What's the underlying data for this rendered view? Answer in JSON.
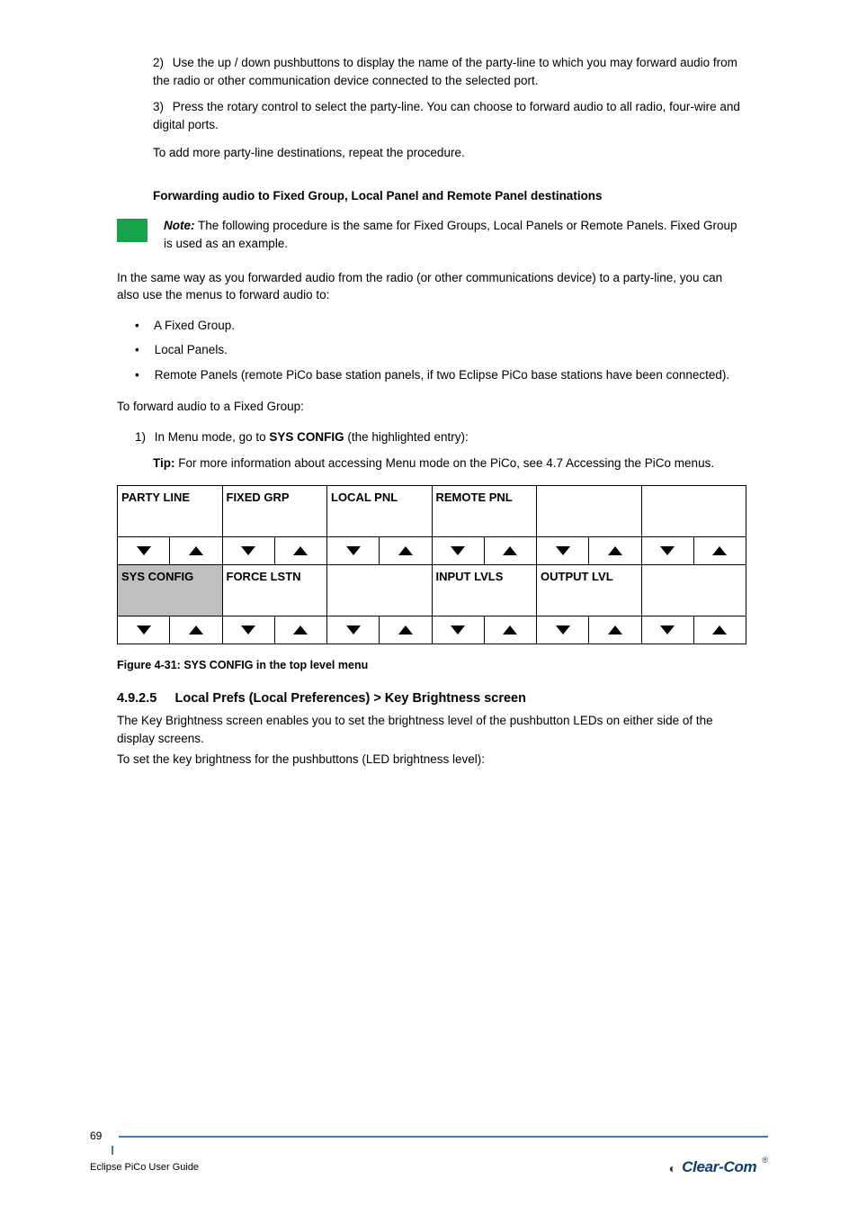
{
  "list": [
    {
      "marker": "2)",
      "text": "Use the up / down pushbuttons to display the name of the party-line to which you may forward audio from the radio or other communication device connected to the selected port."
    },
    {
      "marker": "3)",
      "text": "Press the rotary control to select the party-line. You can choose to forward audio to all radio, four-wire and digital ports."
    }
  ],
  "body1": "To add more party-line destinations, repeat the procedure.",
  "body2": "Forwarding audio to Fixed Group, Local Panel and Remote Panel destinations",
  "note": {
    "kw": "Note:",
    "text": "The following procedure is the same for Fixed Groups, Local Panels or Remote Panels. Fixed Group is used as an example."
  },
  "body3": "In the same way as you forwarded audio from the radio (or other communications device) to a party-line, you can also use the menus to forward audio to:",
  "bullets": [
    {
      "marker": "•",
      "text": "A Fixed Group."
    },
    {
      "marker": "•",
      "text": "Local Panels."
    },
    {
      "marker": "•",
      "text": "Remote Panels (remote PiCo base station panels, if two Eclipse PiCo base stations have been connected)."
    }
  ],
  "body4": "To forward audio to a Fixed Group:",
  "step1": {
    "marker": "1)",
    "text_pre": "In Menu mode, go to ",
    "bold": "SYS CONFIG",
    "text_post": " (the highlighted entry):"
  },
  "tip": {
    "kw": "Tip:",
    "text": "For more information about accessing Menu mode on the PiCo, see 4.7 Accessing the PiCo menus."
  },
  "menu": {
    "row1": [
      "PARTY LINE",
      "FIXED GRP",
      "LOCAL PNL",
      "REMOTE PNL",
      "",
      ""
    ],
    "row2": [
      "SYS CONFIG",
      "FORCE LSTN",
      "",
      "INPUT LVLS",
      "OUTPUT LVL",
      ""
    ],
    "selected": "SYS CONFIG"
  },
  "figure": "Figure 4-31: SYS CONFIG in the top level menu",
  "section_no": "4.9.2.5",
  "section_title": "Local Prefs (Local Preferences) > Key Brightness screen",
  "section_body_a": "The Key Brightness screen enables you to set the brightness level of the pushbutton LEDs on either side of the display screens.",
  "section_body_b": "To set the key brightness for the pushbuttons (LED brightness level):",
  "footer": {
    "page": "69",
    "doc": "Eclipse PiCo User Guide",
    "brand": "Clear-Com"
  }
}
